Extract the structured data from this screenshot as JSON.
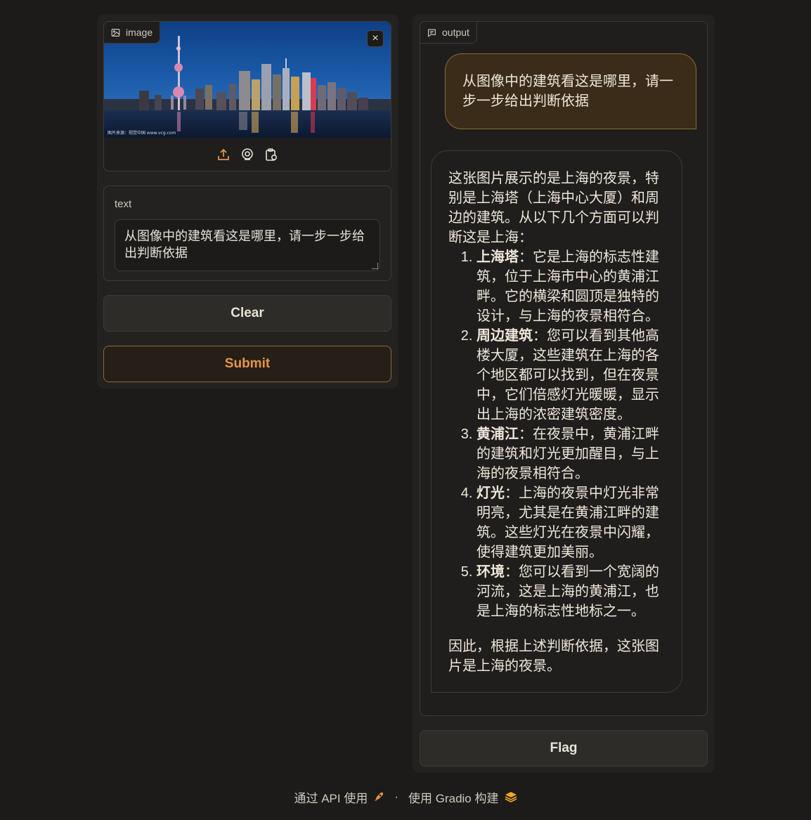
{
  "image_block": {
    "label": "image",
    "watermark": "图片来源：视觉中国 www.vcg.com",
    "close_glyph": "×"
  },
  "text_block": {
    "label": "text",
    "value": "从图像中的建筑看这是哪里，请一步一步给出判断依据"
  },
  "buttons": {
    "clear": "Clear",
    "submit": "Submit",
    "flag": "Flag"
  },
  "output": {
    "label": "output",
    "user_message": "从图像中的建筑看这是哪里，请一步一步给出判断依据",
    "bot_intro": "这张图片展示的是上海的夜景，特别是上海塔（上海中心大厦）和周边的建筑。从以下几个方面可以判断这是上海：",
    "bot_items": [
      {
        "title": "上海塔",
        "text": "：它是上海的标志性建筑，位于上海市中心的黄浦江畔。它的横梁和圆顶是独特的设计，与上海的夜景相符合。"
      },
      {
        "title": "周边建筑",
        "text": "：您可以看到其他高楼大厦，这些建筑在上海的各个地区都可以找到，但在夜景中，它们倍感灯光暖暖，显示出上海的浓密建筑密度。"
      },
      {
        "title": "黄浦江",
        "text": "：在夜景中，黄浦江畔的建筑和灯光更加醒目，与上海的夜景相符合。"
      },
      {
        "title": "灯光",
        "text": "：上海的夜景中灯光非常明亮，尤其是在黄浦江畔的建筑。这些灯光在夜景中闪耀，使得建筑更加美丽。"
      },
      {
        "title": "环境",
        "text": "：您可以看到一个宽阔的河流，这是上海的黄浦江，也是上海的标志性地标之一。"
      }
    ],
    "bot_conclusion": "因此，根据上述判断依据，这张图片是上海的夜景。"
  },
  "footer": {
    "api_link": "通过 API 使用",
    "separator": "·",
    "built_with": "使用 Gradio 构建"
  },
  "colors": {
    "accent": "#e8944a",
    "user_bubble": "#3a2c18",
    "user_border": "#8a6a3a"
  }
}
